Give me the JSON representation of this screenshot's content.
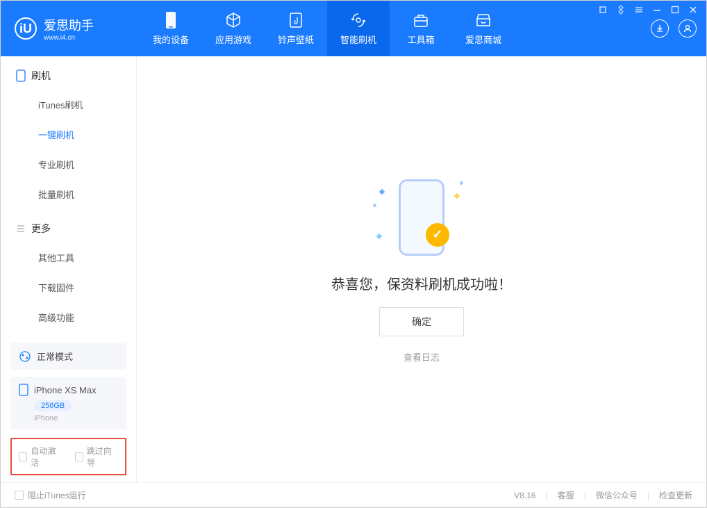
{
  "app": {
    "name": "爱思助手",
    "url": "www.i4.cn"
  },
  "nav": {
    "tabs": [
      {
        "label": "我的设备"
      },
      {
        "label": "应用游戏"
      },
      {
        "label": "铃声壁纸"
      },
      {
        "label": "智能刷机"
      },
      {
        "label": "工具箱"
      },
      {
        "label": "爱思商城"
      }
    ]
  },
  "sidebar": {
    "section1_title": "刷机",
    "section1_items": [
      "iTunes刷机",
      "一键刷机",
      "专业刷机",
      "批量刷机"
    ],
    "section2_title": "更多",
    "section2_items": [
      "其他工具",
      "下载固件",
      "高级功能"
    ],
    "mode_label": "正常模式",
    "device_name": "iPhone XS Max",
    "device_storage": "256GB",
    "device_type": "iPhone",
    "checkbox1": "自动激活",
    "checkbox2": "跳过向导"
  },
  "main": {
    "success_title": "恭喜您，保资料刷机成功啦！",
    "ok_button": "确定",
    "log_link": "查看日志"
  },
  "footer": {
    "block_itunes": "阻止iTunes运行",
    "version": "V8.16",
    "links": [
      "客服",
      "微信公众号",
      "检查更新"
    ]
  }
}
